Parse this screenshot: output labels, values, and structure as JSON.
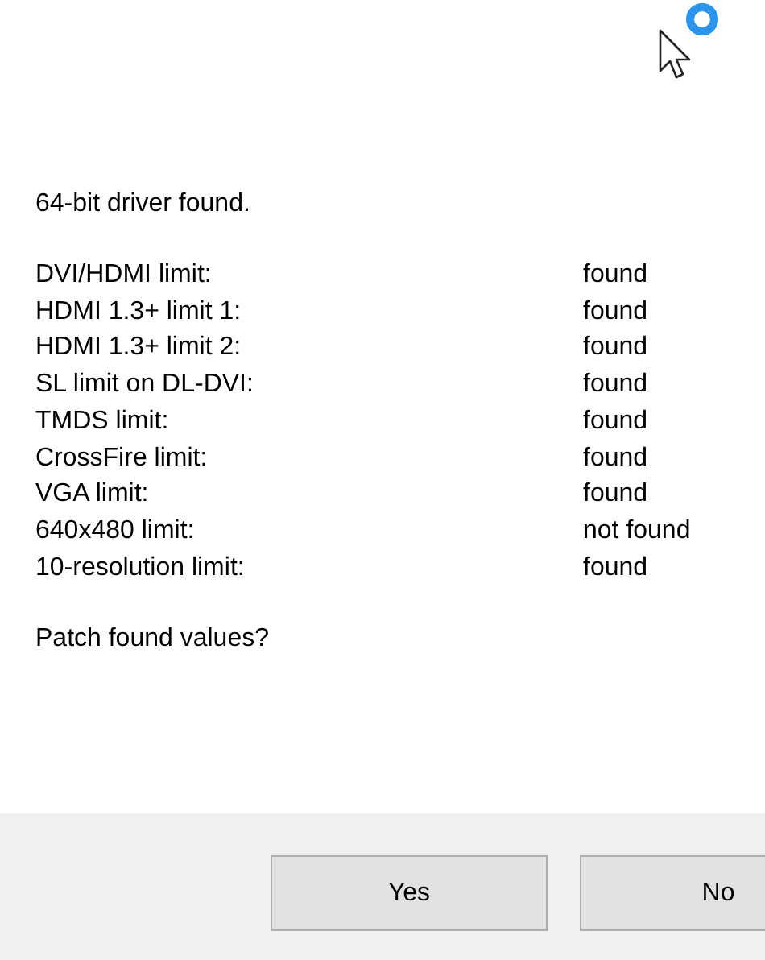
{
  "message": "64-bit driver found.",
  "limits": [
    {
      "name": "DVI/HDMI limit:",
      "status": "found"
    },
    {
      "name": "HDMI 1.3+ limit 1:",
      "status": "found"
    },
    {
      "name": "HDMI 1.3+ limit 2:",
      "status": "found"
    },
    {
      "name": "SL limit on DL-DVI:",
      "status": "found"
    },
    {
      "name": "TMDS limit:",
      "status": "found"
    },
    {
      "name": "CrossFire limit:",
      "status": "found"
    },
    {
      "name": "VGA limit:",
      "status": "found"
    },
    {
      "name": "640x480 limit:",
      "status": "not found"
    },
    {
      "name": "10-resolution limit:",
      "status": "found"
    }
  ],
  "question": "Patch found values?",
  "buttons": [
    "Yes",
    "No"
  ]
}
